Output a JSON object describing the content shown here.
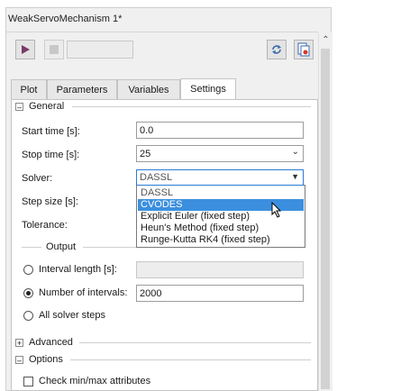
{
  "window": {
    "title": "WeakServoMechanism 1*"
  },
  "toolbar": {
    "play_icon": "play-icon",
    "stop_icon": "stop-icon",
    "reload_icon": "reload-icon",
    "export_icon": "export-icon"
  },
  "tabs": [
    {
      "label": "Plot"
    },
    {
      "label": "Parameters"
    },
    {
      "label": "Variables"
    },
    {
      "label": "Settings",
      "active": true
    }
  ],
  "general": {
    "label": "General",
    "start_time": {
      "label": "Start time [s]:",
      "value": "0.0"
    },
    "stop_time": {
      "label": "Stop time [s]:",
      "value": "25"
    },
    "solver": {
      "label": "Solver:",
      "value": "DASSL"
    },
    "step_size": {
      "label": "Step size [s]:"
    },
    "tolerance": {
      "label": "Tolerance:"
    }
  },
  "solver_options": [
    {
      "label": "DASSL"
    },
    {
      "label": "CVODES",
      "selected": true
    },
    {
      "label": "Explicit Euler (fixed step)"
    },
    {
      "label": "Heun's Method (fixed step)"
    },
    {
      "label": "Runge-Kutta RK4 (fixed step)"
    }
  ],
  "output": {
    "label": "Output",
    "interval_length": {
      "label": "Interval length [s]:",
      "value": ""
    },
    "number_of_intervals": {
      "label": "Number of intervals:",
      "value": "2000",
      "checked": true
    },
    "all_solver_steps": {
      "label": "All solver steps"
    }
  },
  "advanced": {
    "label": "Advanced"
  },
  "options": {
    "label": "Options",
    "check_min_max": {
      "label": "Check min/max attributes",
      "checked": false
    }
  },
  "colors": {
    "selection": "#3c8fde",
    "focus_border": "#2a7ad5"
  }
}
